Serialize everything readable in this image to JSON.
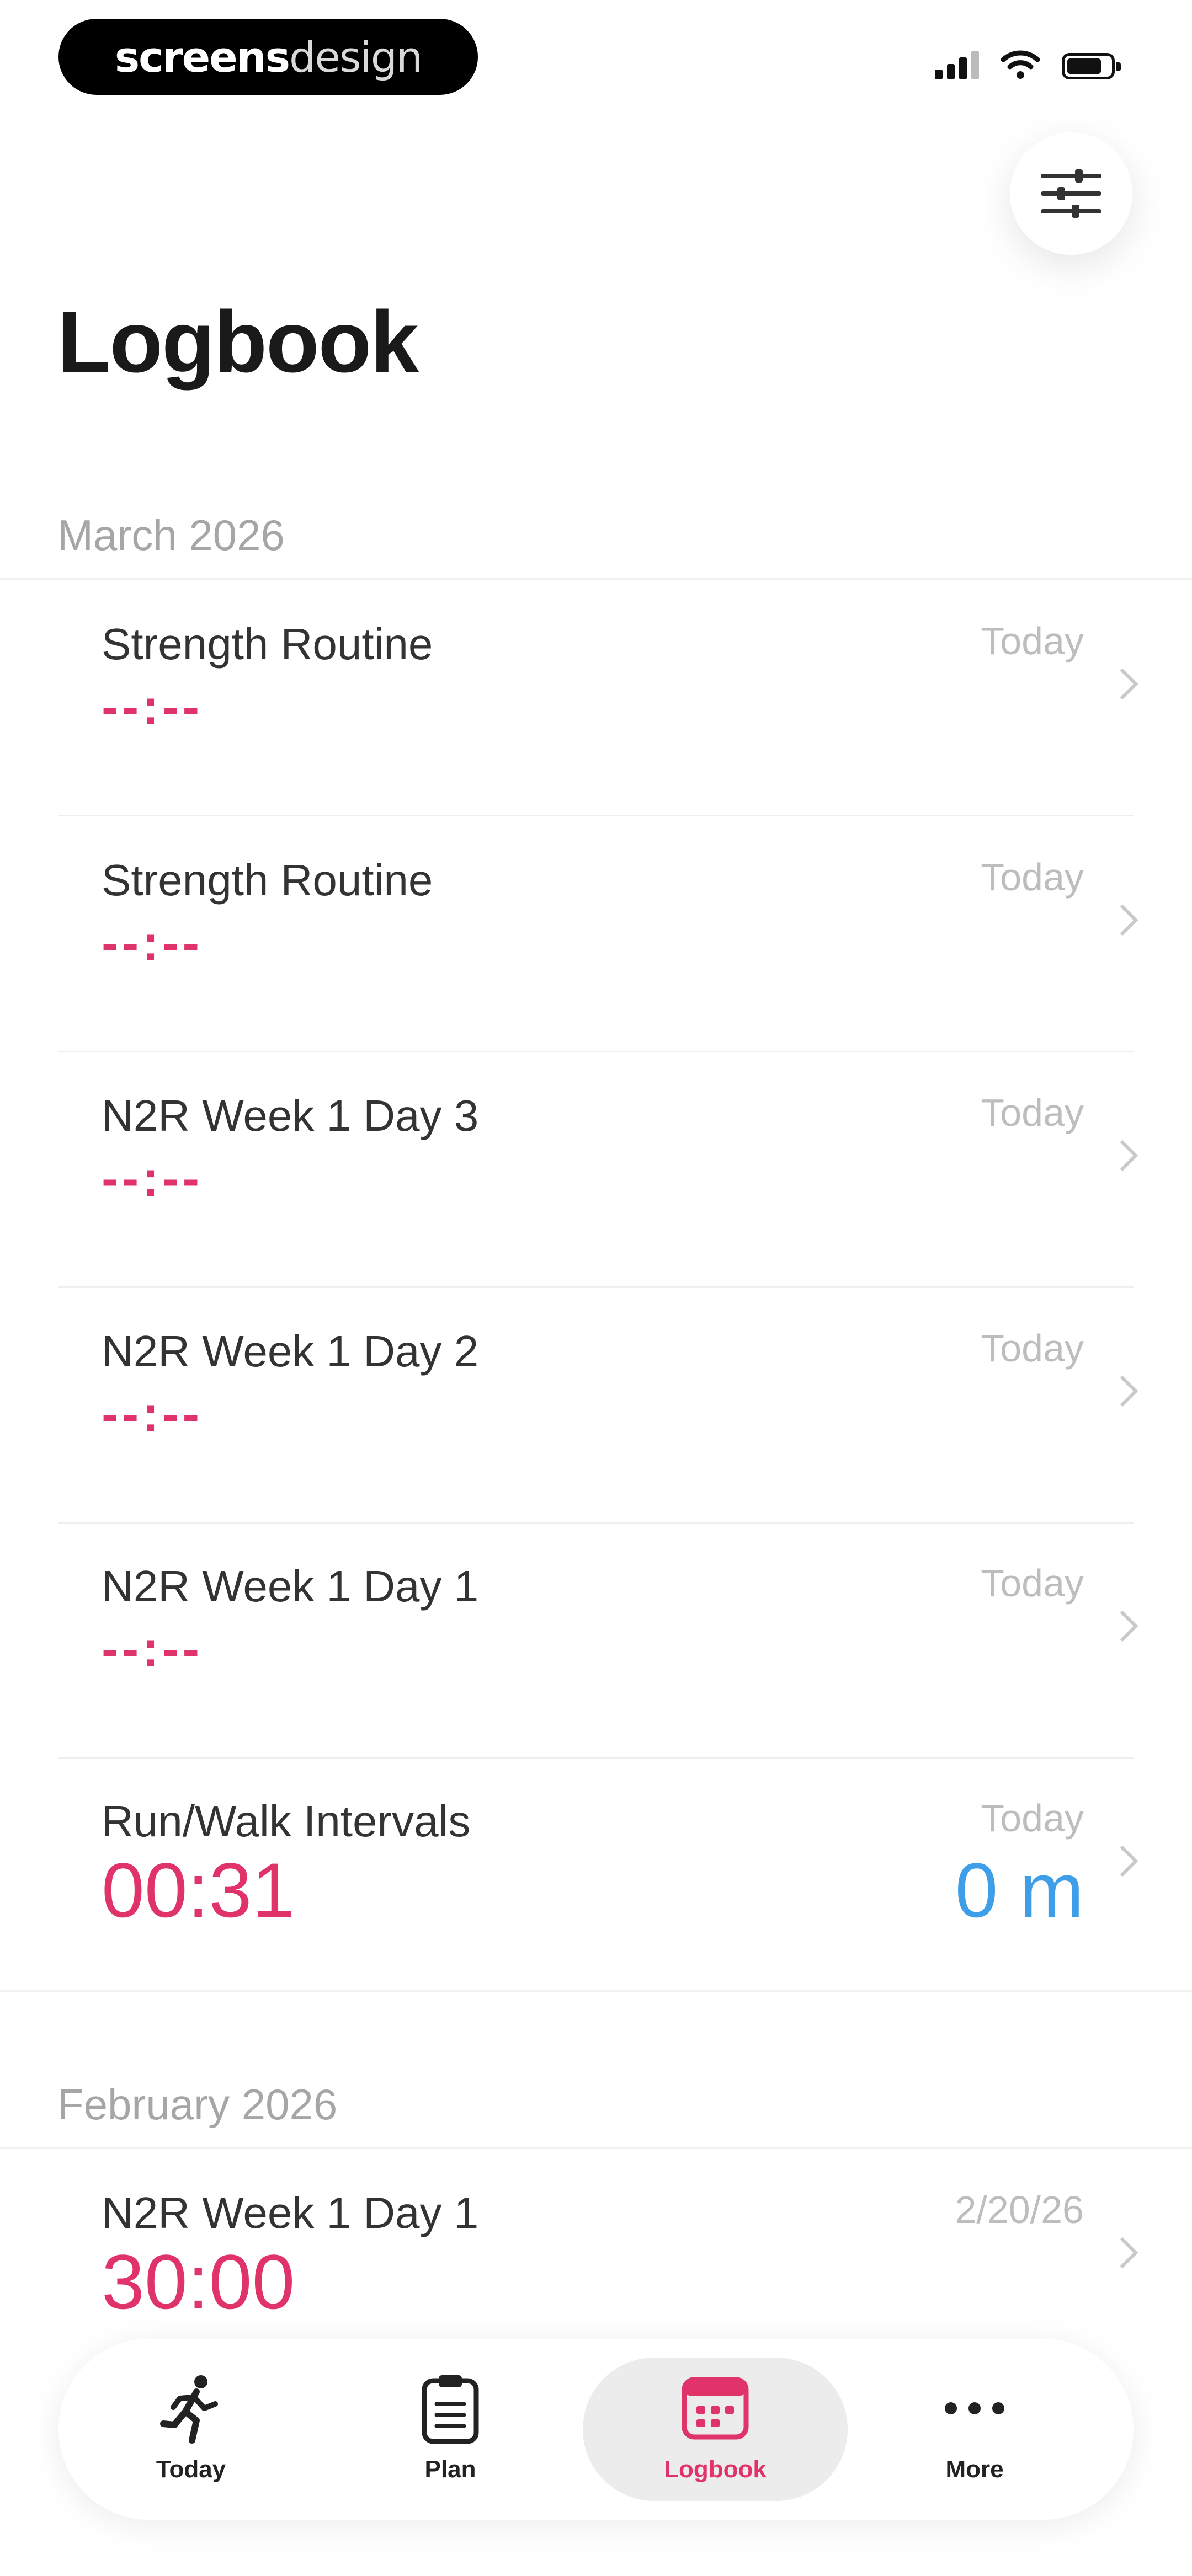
{
  "watermark": {
    "bold": "screens",
    "light": "design"
  },
  "page_title": "Logbook",
  "sections": [
    {
      "label": "March 2026",
      "entries": [
        {
          "name": "Strength Routine",
          "date": "Today",
          "time": "--:--",
          "distance": ""
        },
        {
          "name": "Strength Routine",
          "date": "Today",
          "time": "--:--",
          "distance": ""
        },
        {
          "name": "N2R Week 1 Day 3",
          "date": "Today",
          "time": "--:--",
          "distance": ""
        },
        {
          "name": "N2R Week 1 Day 2",
          "date": "Today",
          "time": "--:--",
          "distance": ""
        },
        {
          "name": "N2R Week 1 Day 1",
          "date": "Today",
          "time": "--:--",
          "distance": ""
        },
        {
          "name": "Run/Walk Intervals",
          "date": "Today",
          "time": "00:31",
          "distance": "0 m"
        }
      ]
    },
    {
      "label": "February 2026",
      "entries": [
        {
          "name": "N2R Week 1 Day 1",
          "date": "2/20/26",
          "time": "30:00",
          "distance": ""
        }
      ]
    }
  ],
  "tabs": [
    {
      "label": "Today",
      "icon": "runner-icon",
      "active": false
    },
    {
      "label": "Plan",
      "icon": "clipboard-icon",
      "active": false
    },
    {
      "label": "Logbook",
      "icon": "calendar-icon",
      "active": true
    },
    {
      "label": "More",
      "icon": "more-dots-icon",
      "active": false
    }
  ],
  "colors": {
    "accent": "#e0336a",
    "distance": "#3f9ee8",
    "muted": "#a6a6a6"
  }
}
